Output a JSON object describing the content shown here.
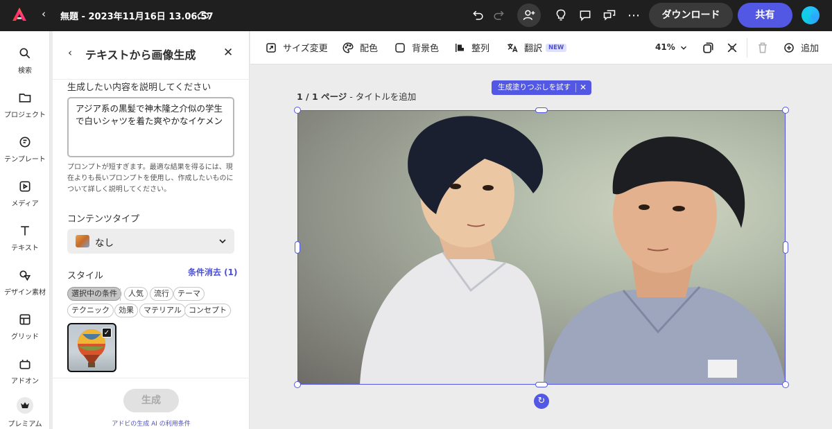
{
  "topbar": {
    "title": "無題 - 2023年11月16日 13.06.57",
    "download_label": "ダウンロード",
    "share_label": "共有",
    "icons": [
      "adobe-express-logo",
      "back-chevron",
      "cloud-icon",
      "undo-icon",
      "redo-icon",
      "invite-icon",
      "lightbulb-icon",
      "comment-icon",
      "share-comment-icon",
      "more-icon"
    ]
  },
  "rail": {
    "items": [
      {
        "label": "検索",
        "icon": "search-icon"
      },
      {
        "label": "プロジェクト",
        "icon": "folder-icon"
      },
      {
        "label": "テンプレート",
        "icon": "template-icon"
      },
      {
        "label": "メディア",
        "icon": "media-icon"
      },
      {
        "label": "テキスト",
        "icon": "text-icon"
      },
      {
        "label": "デザイン素材",
        "icon": "shapes-icon"
      },
      {
        "label": "グリッド",
        "icon": "grid-icon"
      },
      {
        "label": "アドオン",
        "icon": "addon-icon"
      },
      {
        "label": "プレミアム",
        "icon": "premium-icon"
      }
    ]
  },
  "panel": {
    "title": "テキストから画像生成",
    "describe_label": "生成したい内容を説明してください",
    "prompt_value": "アジア系の黒髪で神木隆之介似の学生で白いシャツを着た爽やかなイケメン",
    "hint": "プロンプトが短すぎます。最適な結果を得るには、現在よりも長いプロンプトを使用し、作成したいものについて詳しく説明してください。",
    "content_type_label": "コンテンツタイプ",
    "content_type_value": "なし",
    "style_label": "スタイル",
    "clear_filters": "条件消去 (1)",
    "chips": [
      "選択中の条件",
      "人気",
      "流行",
      "テーマ",
      "テクニック",
      "効果",
      "マテリアル",
      "コンセプト"
    ],
    "generate_label": "生成",
    "terms_link": "アドビの生成 AI の利用条件"
  },
  "toolbar": {
    "resize": "サイズ変更",
    "color": "配色",
    "background": "背景色",
    "align": "整列",
    "translate": "翻訳",
    "new_badge": "NEW",
    "zoom": "41%",
    "add": "追加"
  },
  "canvas": {
    "page_number": "1 / 1 ページ",
    "page_title": " - タイトルを追加",
    "genfill_label": "生成塗りつぶしを試す"
  },
  "colors": {
    "accent": "#5258e4",
    "topbar_bg": "#1f1f1f"
  }
}
